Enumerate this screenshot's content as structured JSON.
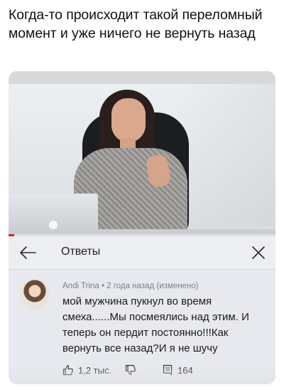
{
  "post": {
    "caption": "Когда-то происходит такой переломный момент и уже ничего не вернуть назад"
  },
  "video": {
    "progress_fraction": 0.02,
    "progress_color": "#e02020"
  },
  "replies_panel": {
    "back_icon": "arrow-left-icon",
    "title": "Ответы",
    "close_icon": "close-icon"
  },
  "comment": {
    "author": "Andi Trina",
    "meta_rest": " • 2 года назад (изменено)",
    "text": "мой мужчина пукнул во время смеха......Мы посмеялись над этим. И теперь он пердит постоянно!!!Как вернуть все назад?И я не шучу",
    "likes": "1,2 тыс.",
    "replies": "164",
    "like_icon": "thumbs-up-icon",
    "dislike_icon": "thumbs-down-icon",
    "reply_icon": "comment-icon"
  }
}
